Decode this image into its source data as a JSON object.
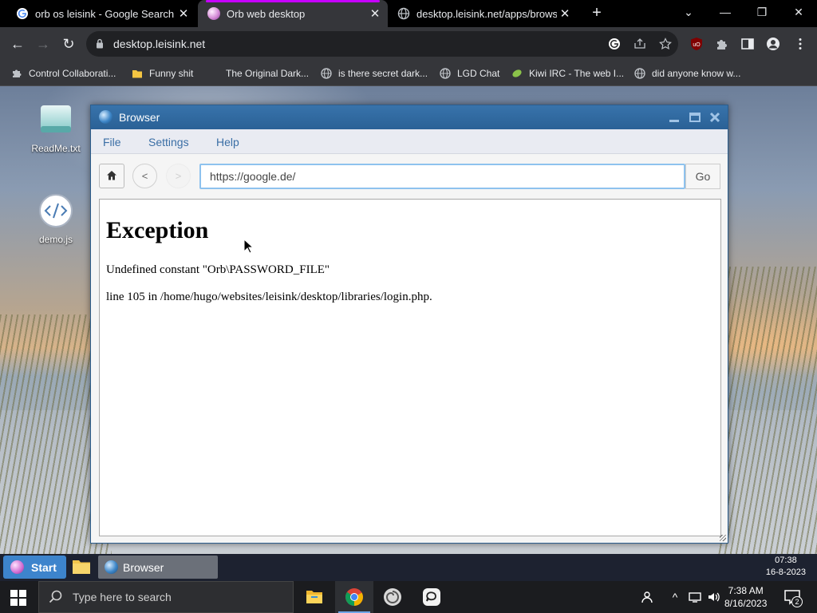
{
  "chrome": {
    "tabs": [
      {
        "title": "orb os leisink - Google Search",
        "active": false
      },
      {
        "title": "Orb web desktop",
        "active": true
      },
      {
        "title": "desktop.leisink.net/apps/browser",
        "active": false
      }
    ],
    "address": "desktop.leisink.net",
    "bookmarks": [
      {
        "label": "Control Collaborati...",
        "icon": "puzzle-icon"
      },
      {
        "label": "Funny shit",
        "icon": "folder-icon"
      },
      {
        "label": "The Original Dark...",
        "icon": "none"
      },
      {
        "label": "is there secret dark...",
        "icon": "globe-icon"
      },
      {
        "label": "LGD Chat",
        "icon": "globe-icon"
      },
      {
        "label": "Kiwi IRC - The web I...",
        "icon": "kiwi-icon"
      },
      {
        "label": "did anyone know w...",
        "icon": "globe-icon"
      }
    ]
  },
  "desktop": {
    "icons": [
      {
        "label": "ReadMe.txt",
        "icon": "text-file-icon"
      },
      {
        "label": "demo.js",
        "icon": "code-icon"
      }
    ]
  },
  "app": {
    "title": "Browser",
    "menu": [
      "File",
      "Settings",
      "Help"
    ],
    "back_label": "<",
    "forward_label": ">",
    "url": "https://google.de/",
    "go_label": "Go",
    "page": {
      "heading": "Exception",
      "message": "Undefined constant \"Orb\\PASSWORD_FILE\"",
      "location": "line 105 in /home/hugo/websites/leisink/desktop/libraries/login.php."
    }
  },
  "orb_taskbar": {
    "start_label": "Start",
    "task_label": "Browser",
    "time": "07:38",
    "date": "16-8-2023"
  },
  "windows_taskbar": {
    "search_placeholder": "Type here to search",
    "time": "7:38 AM",
    "date": "8/16/2023",
    "notification_count": "2"
  },
  "colors": {
    "active_tab_accent": "#c600ff",
    "orb_titlebar": "#2a6196",
    "orb_start": "#3d84cc",
    "link_blue": "#3a6ea5"
  }
}
